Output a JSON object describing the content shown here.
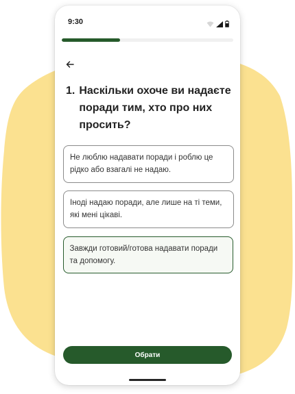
{
  "status_bar": {
    "time": "9:30",
    "icons": [
      "wifi-icon",
      "cellular-signal-icon",
      "battery-icon"
    ]
  },
  "progress": {
    "fraction": 0.34
  },
  "navigation": {
    "back_icon": "arrow-left-icon"
  },
  "question": {
    "number": "1.",
    "text": "Наскільки охоче ви надаєте поради тим, хто про них просить?"
  },
  "options": [
    {
      "label": "Не люблю надавати поради і роблю це рідко або взагалі не надаю.",
      "selected": false
    },
    {
      "label": "Іноді надаю поради, але лише на ті теми, які мені цікаві.",
      "selected": false
    },
    {
      "label": "Завжди готовий/готова надавати поради та допомогу.",
      "selected": true
    }
  ],
  "submit": {
    "label": "Обрати"
  },
  "colors": {
    "accent": "#265a2b",
    "background_blob": "#fbe190",
    "selected_option_bg": "#f6f9f4"
  }
}
